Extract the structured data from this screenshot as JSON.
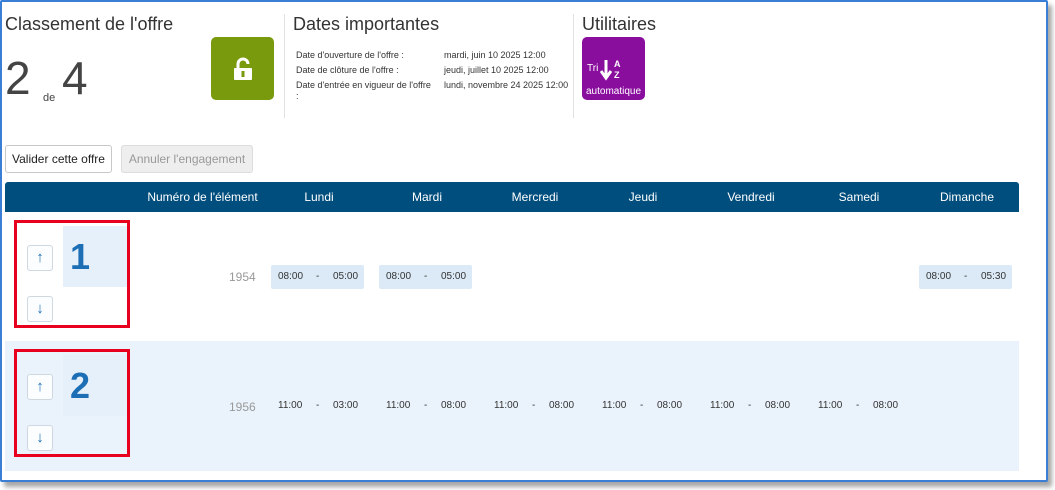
{
  "ranking": {
    "title": "Classement de l'offre",
    "position": "2",
    "of_label": "de",
    "total": "4"
  },
  "dates": {
    "title": "Dates importantes",
    "rows": [
      {
        "label": "Date d'ouverture de l'offre :",
        "value": "mardi, juin 10 2025 12:00"
      },
      {
        "label": "Date de clôture de l'offre :",
        "value": "jeudi, juillet 10 2025 12:00"
      },
      {
        "label": "Date d'entrée en vigueur de l'offre :",
        "value": "lundi, novembre 24 2025 12:00"
      }
    ]
  },
  "utilities": {
    "title": "Utilitaires",
    "sort_prefix": "Tri",
    "sort_label": "automatique"
  },
  "actions": {
    "validate": "Valider cette offre",
    "cancel": "Annuler l'engagement"
  },
  "table": {
    "headers": [
      "Numéro de l'élément",
      "Lundi",
      "Mardi",
      "Mercredi",
      "Jeudi",
      "Vendredi",
      "Samedi",
      "Dimanche"
    ],
    "rows": [
      {
        "rank": "1",
        "item": "1954",
        "slots": [
          {
            "start": "08:00",
            "dash": "-",
            "end": "05:00"
          },
          {
            "start": "08:00",
            "dash": "-",
            "end": "05:00"
          },
          null,
          null,
          null,
          null,
          {
            "start": "08:00",
            "dash": "-",
            "end": "05:30"
          }
        ]
      },
      {
        "rank": "2",
        "item": "1956",
        "slots": [
          {
            "start": "11:00",
            "dash": "-",
            "end": "03:00"
          },
          {
            "start": "11:00",
            "dash": "-",
            "end": "08:00"
          },
          {
            "start": "11:00",
            "dash": "-",
            "end": "08:00"
          },
          {
            "start": "11:00",
            "dash": "-",
            "end": "08:00"
          },
          {
            "start": "11:00",
            "dash": "-",
            "end": "08:00"
          },
          {
            "start": "11:00",
            "dash": "-",
            "end": "08:00"
          },
          null
        ]
      }
    ]
  },
  "arrows": {
    "up": "↑",
    "down": "↓"
  },
  "colors": {
    "header_bg": "#004e7d",
    "unlock_tile": "#7a9a0d",
    "sort_tile": "#8a0e9e",
    "highlight_border": "#e8001f",
    "rank_number": "#1d6fb5",
    "row_alt": "#eaf3fb"
  },
  "icons": {
    "unlock": "unlock-icon",
    "sort": "sort-az-icon",
    "up": "arrow-up-icon",
    "down": "arrow-down-icon"
  }
}
